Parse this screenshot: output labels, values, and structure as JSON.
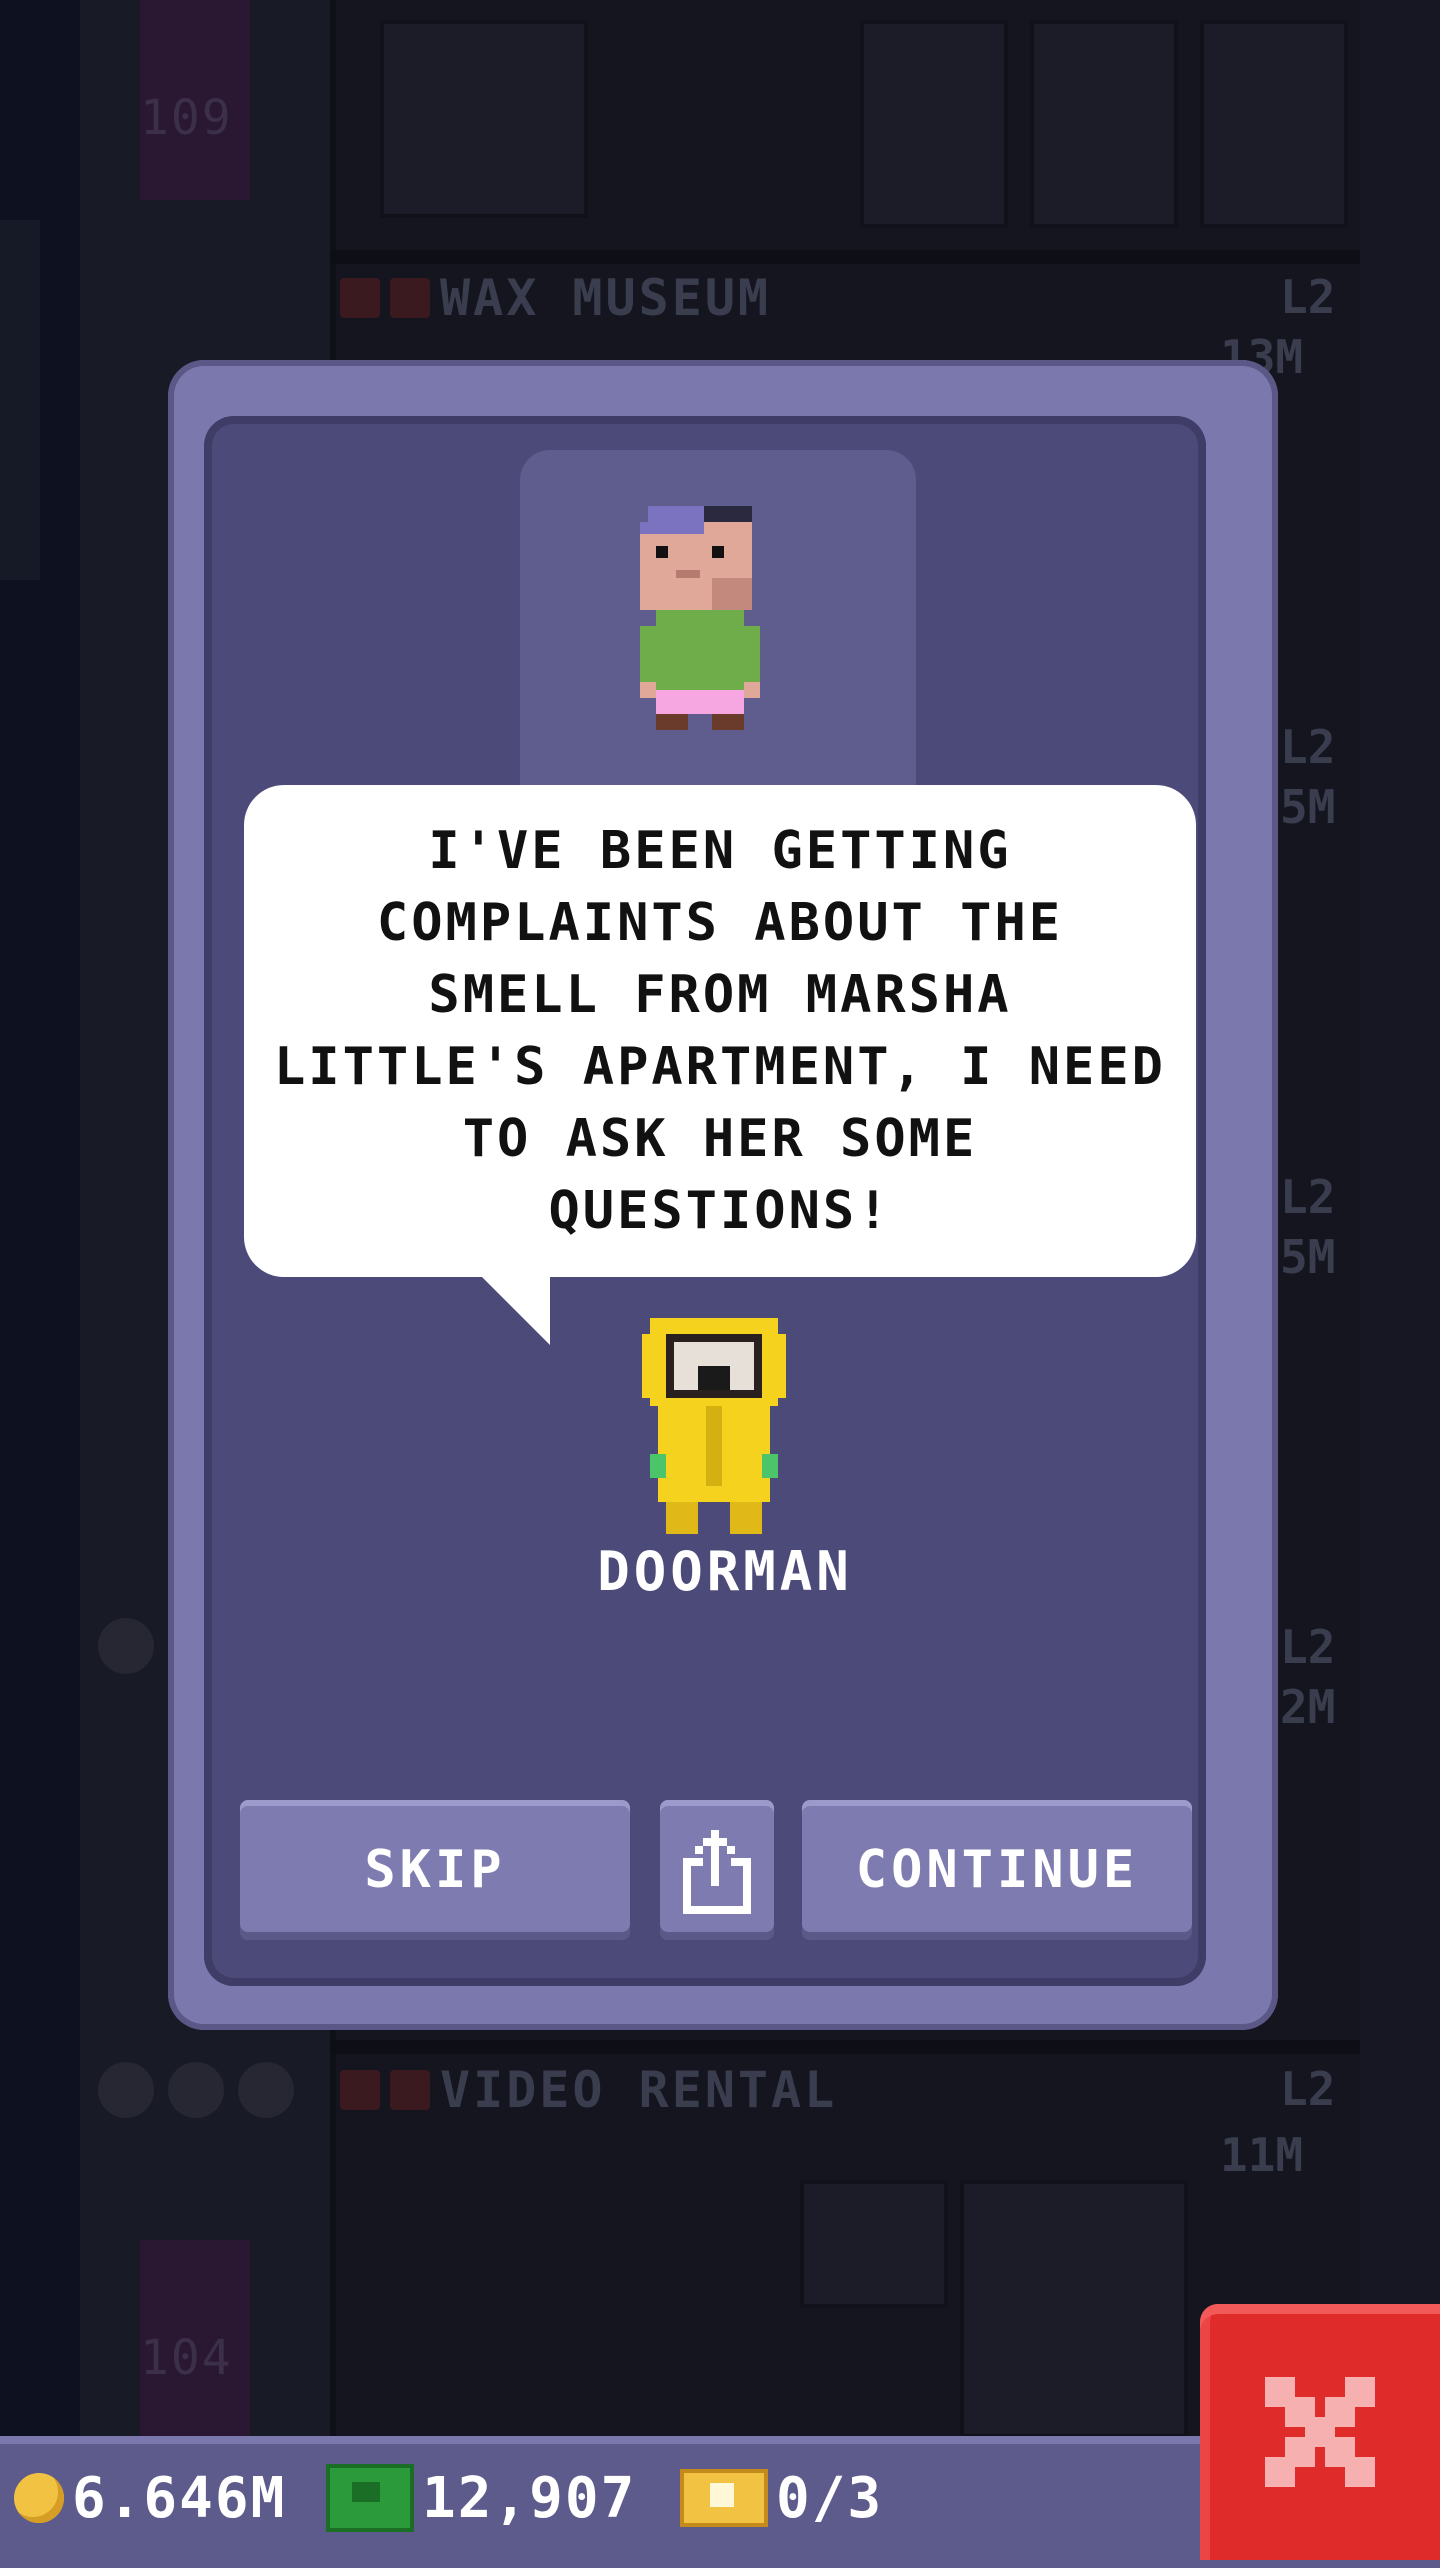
{
  "background": {
    "floors": [
      {
        "name": "WAX MUSEUM",
        "level": "L2",
        "price": "13M"
      },
      {
        "name": "VIDEO RENTAL",
        "level": "L2",
        "price": "11M"
      }
    ],
    "floor_numbers": [
      "109",
      "104"
    ],
    "side_levels": [
      "L2",
      "L2",
      "L2"
    ],
    "side_prices": [
      "5M",
      "5M",
      "2M"
    ]
  },
  "dialog": {
    "message": "I'VE BEEN GETTING\nCOMPLAINTS ABOUT THE\nSMELL FROM MARSHA\nLITTLE'S APARTMENT, I NEED\nTO ASK HER SOME\nQUESTIONS!",
    "speaker": "DOORMAN",
    "buttons": {
      "skip": "SKIP",
      "share_icon": "share-icon",
      "continue": "CONTINUE"
    }
  },
  "status_bar": {
    "coins": "6.646M",
    "bux": "12,907",
    "tickets": "0/3"
  },
  "colors": {
    "dialog_outer": "#7b78ad",
    "dialog_inner": "#4c4a79",
    "button": "#7d7bb0",
    "close_button": "#e02b2b",
    "raincoat": "#f4d21e"
  }
}
